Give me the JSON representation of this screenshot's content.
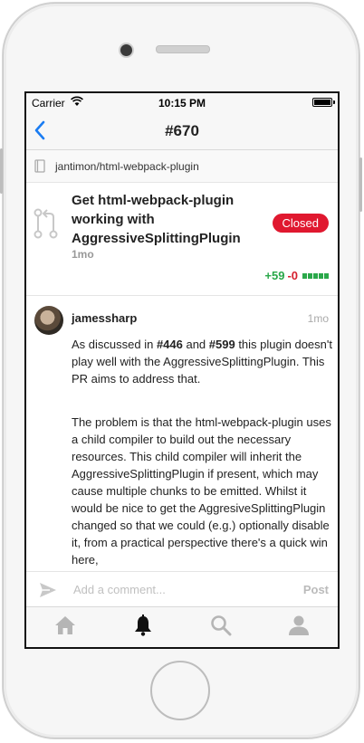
{
  "status": {
    "carrier": "Carrier",
    "time": "10:15 PM"
  },
  "nav": {
    "title": "#670"
  },
  "repo": {
    "name": "jantimon/html-webpack-plugin"
  },
  "pr": {
    "title": "Get html-webpack-plugin working with AggressiveSplittingPlugin",
    "age": "1mo",
    "state": "Closed",
    "additions": "+59",
    "deletions": "-0"
  },
  "comment": {
    "author": "jamessharp",
    "time": "1mo",
    "p1_a": "As discussed in ",
    "p1_ref1": "#446",
    "p1_b": " and ",
    "p1_ref2": "#599",
    "p1_c": " this plugin doesn't play well with the AggressiveSplittingPlugin. This PR aims to address that.",
    "p2": "The problem is that the html-webpack-plugin uses a child compiler to build out the necessary resources. This child compiler will inherit the AggressiveSplittingPlugin if present, which may cause multiple chunks to be emitted. Whilst it would be nice to get the AggresiveSplittingPlugin changed so that we could (e.g.) optionally disable it, from a practical perspective there's a quick win here,"
  },
  "compose": {
    "placeholder": "Add a comment...",
    "post": "Post"
  },
  "tabs": [
    "home-icon",
    "bell-icon",
    "search-icon",
    "person-icon"
  ],
  "colors": {
    "accent": "#1a7cf2",
    "closed": "#e0182f",
    "add": "#2aa84a",
    "del": "#d6202f"
  }
}
